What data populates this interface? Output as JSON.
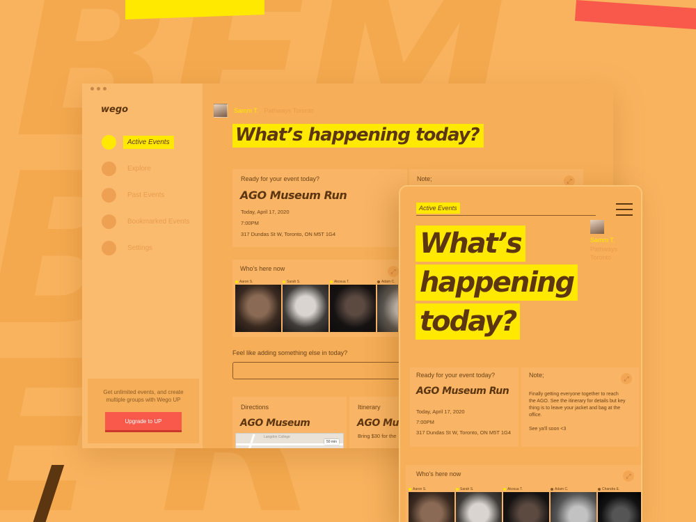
{
  "app": {
    "logo": "wego"
  },
  "sidebar": {
    "items": [
      {
        "label": "Active Events",
        "active": true
      },
      {
        "label": "Explore",
        "active": false
      },
      {
        "label": "Past Events",
        "active": false
      },
      {
        "label": "Bookmarked Events",
        "active": false
      },
      {
        "label": "Settings",
        "active": false
      }
    ],
    "upgrade_text": "Get unlimited events, and create multiple groups with Wego UP",
    "upgrade_button": "Upgrade to UP"
  },
  "user": {
    "name": "Samm T.",
    "group": "Pathways Toronto"
  },
  "headline": "What’s happening today?",
  "event_card": {
    "label": "Ready for your event today?",
    "title": "AGO Museum Run",
    "date": "Today, April 17, 2020",
    "time": "7:00PM",
    "address": "317 Dundas St W, Toronto, ON M5T 1G4"
  },
  "note_card": {
    "label": "Note;",
    "text": "Finally getting everyone together to reach the AGO. See the itinerary for details but key thing is to leave your jacket and bag at the office.",
    "signoff": "See ya'll soon <3"
  },
  "whos_here": {
    "label": "Who's here now",
    "people": [
      {
        "name": "Aaron S."
      },
      {
        "name": "Sarah S."
      },
      {
        "name": "Akosua T."
      },
      {
        "name": "Adam C."
      },
      {
        "name": "Chandra E."
      }
    ]
  },
  "add_prompt": "Feel like adding something else in today?",
  "directions": {
    "label": "Directions",
    "title": "AGO Museum",
    "map_label": "Langdon College",
    "map_badge": "50 min"
  },
  "itinerary": {
    "label": "Itinerary",
    "title": "AGO Mu",
    "text": "Bring $30 for the"
  },
  "tablet": {
    "active_label": "Active Events",
    "headline_lines": [
      "What’s",
      "happening",
      "today?"
    ]
  },
  "colors": {
    "accent": "#ffe900",
    "brand_bg": "#f9b35f",
    "cta": "#f8594a",
    "text": "#5c3511"
  }
}
